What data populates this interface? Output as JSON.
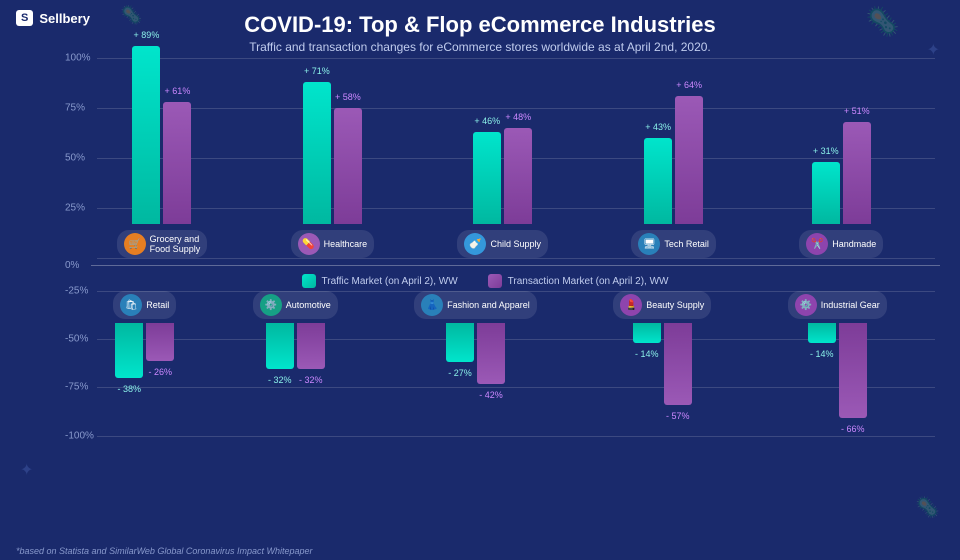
{
  "app": {
    "logo": "Sellbery",
    "title": "COVID-19: Top & Flop eCommerce Industries",
    "subtitle": "Traffic and transaction changes for eCommerce stores worldwide as at April 2nd, 2020.",
    "footnote": "*based on Statista and SimilarWeb Global Coronavirus Impact Whitepaper"
  },
  "legend": {
    "traffic_label": "Traffic Market (on April 2), WW",
    "transaction_label": "Transaction Market (on April 2), WW",
    "traffic_color": "#00e5cc",
    "transaction_color": "#9b59b6"
  },
  "y_labels": {
    "top": [
      "100%",
      "75%",
      "50%",
      "25%"
    ],
    "zero": "0%",
    "bottom": [
      "-25%",
      "-50%",
      "-75%",
      "-100%"
    ]
  },
  "top_categories": [
    {
      "name": "Grocery and\nFood Supply",
      "icon": "🛒",
      "icon_bg": "#e67e22",
      "traffic": 89,
      "transaction": 61,
      "traffic_label": "+ 89%",
      "transaction_label": "+ 61%"
    },
    {
      "name": "Healthcare",
      "icon": "💊",
      "icon_bg": "#9b59b6",
      "traffic": 71,
      "transaction": 58,
      "traffic_label": "+ 71%",
      "transaction_label": "+ 58%"
    },
    {
      "name": "Child Supply",
      "icon": "🍼",
      "icon_bg": "#3498db",
      "traffic": 46,
      "transaction": 48,
      "traffic_label": "+ 46%",
      "transaction_label": "+ 48%"
    },
    {
      "name": "Tech Retail",
      "icon": "🖥",
      "icon_bg": "#2980b9",
      "traffic": 43,
      "transaction": 64,
      "traffic_label": "+ 43%",
      "transaction_label": "+ 64%"
    },
    {
      "name": "Handmade",
      "icon": "✂️",
      "icon_bg": "#8e44ad",
      "traffic": 31,
      "transaction": 51,
      "traffic_label": "+ 31%",
      "transaction_label": "+ 51%"
    }
  ],
  "bottom_categories": [
    {
      "name": "Retail",
      "icon": "🛍",
      "icon_bg": "#2980b9",
      "traffic": -38,
      "transaction": -26,
      "traffic_label": "- 38%",
      "transaction_label": "- 26%"
    },
    {
      "name": "Automotive",
      "icon": "⚙️",
      "icon_bg": "#16a085",
      "traffic": -32,
      "transaction": -32,
      "traffic_label": "- 32%",
      "transaction_label": "- 32%"
    },
    {
      "name": "Fashion and Apparel",
      "icon": "👗",
      "icon_bg": "#2980b9",
      "traffic": -27,
      "transaction": -42,
      "traffic_label": "- 27%",
      "transaction_label": "- 42%"
    },
    {
      "name": "Beauty Supply",
      "icon": "💄",
      "icon_bg": "#8e44ad",
      "traffic": -14,
      "transaction": -57,
      "traffic_label": "- 14%",
      "transaction_label": "- 57%"
    },
    {
      "name": "Industrial Gear",
      "icon": "⚙️",
      "icon_bg": "#8e44ad",
      "traffic": -14,
      "transaction": -66,
      "traffic_label": "- 14%",
      "transaction_label": "- 66%"
    }
  ]
}
